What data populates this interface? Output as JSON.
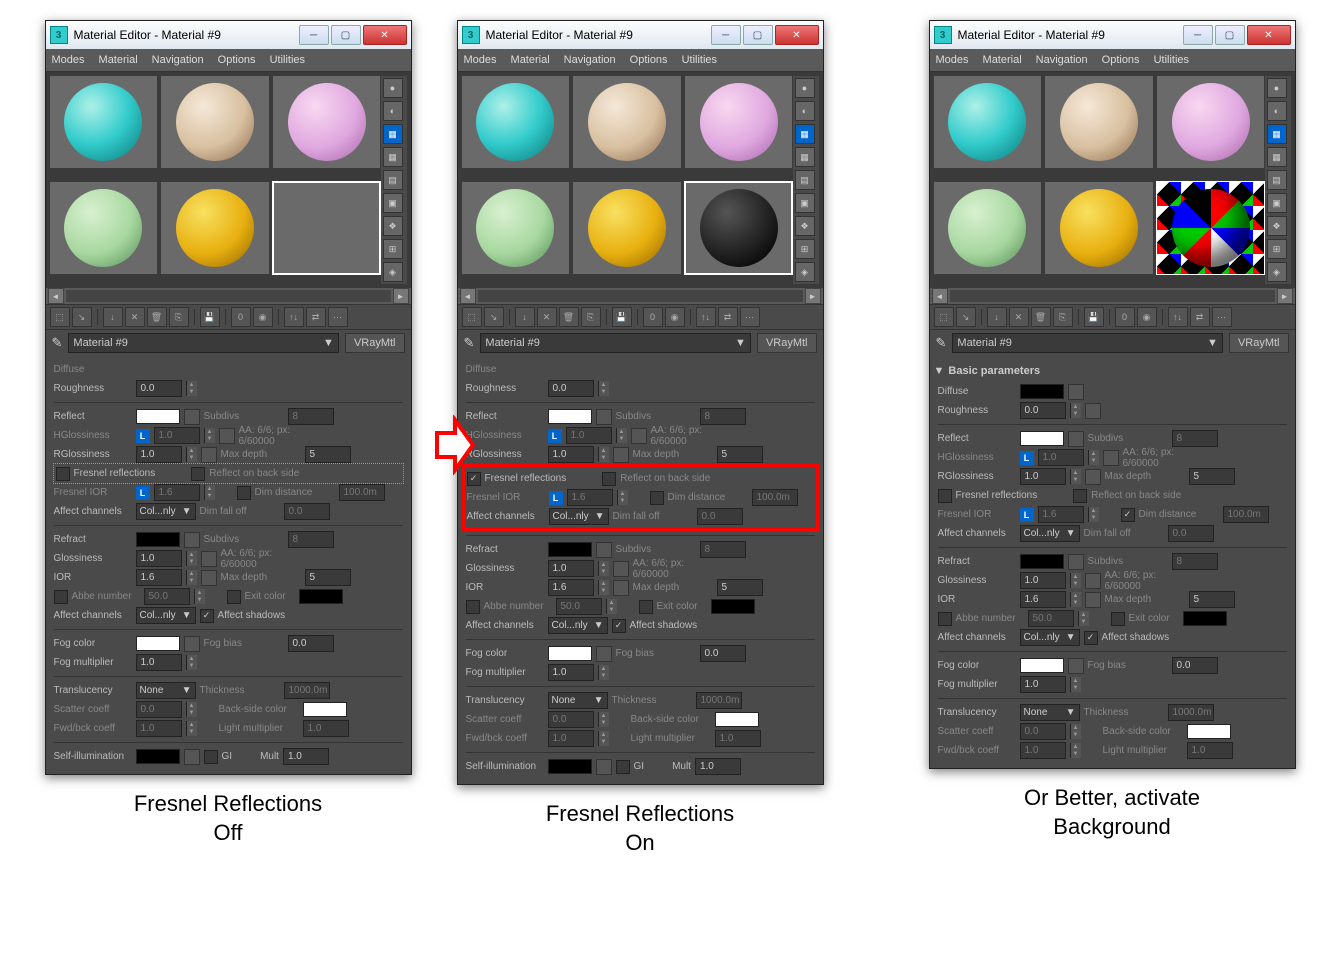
{
  "title": "Material Editor - Material #9",
  "menu": [
    "Modes",
    "Material",
    "Navigation",
    "Options",
    "Utilities"
  ],
  "material_name": "Material #9",
  "material_type": "VRayMtl",
  "rollout": "Basic parameters",
  "labels": {
    "diffuse": "Diffuse",
    "roughness": "Roughness",
    "reflect": "Reflect",
    "hgloss": "HGlossiness",
    "rgloss": "RGlossiness",
    "fresnel": "Fresnel reflections",
    "fresnelior": "Fresnel IOR",
    "affectch": "Affect channels",
    "subdivs": "Subdivs",
    "aa": "AA: 6/6; px: 6/60000",
    "maxdepth": "Max depth",
    "backside": "Reflect on back side",
    "dimdist": "Dim distance",
    "dimfall": "Dim fall off",
    "refract": "Refract",
    "gloss": "Glossiness",
    "ior": "IOR",
    "abbe": "Abbe number",
    "exit": "Exit color",
    "shadows": "Affect shadows",
    "fog": "Fog color",
    "fogmult": "Fog multiplier",
    "fogbias": "Fog bias",
    "trans": "Translucency",
    "thick": "Thickness",
    "scatter": "Scatter coeff",
    "backcol": "Back-side color",
    "fwdbck": "Fwd/bck coeff",
    "lightmult": "Light multiplier",
    "selfillum": "Self-illumination",
    "gi": "GI",
    "mult": "Mult"
  },
  "vals": {
    "roughness": "0.0",
    "hgloss": "1.0",
    "rgloss": "1.0",
    "fresnelior": "1.6",
    "subdivs": "8",
    "maxdepth": "5",
    "dimdist": "100.0m",
    "dimfall": "0.0",
    "gloss": "1.0",
    "ior": "1.6",
    "abbe": "50.0",
    "refr_subdivs": "8",
    "refr_maxdepth": "5",
    "fogmult": "1.0",
    "fogbias": "0.0",
    "thick": "1000.0m",
    "scatter": "0.0",
    "fwdbck": "1.0",
    "lightmult": "1.0",
    "mult": "1.0",
    "affectch": "Col...nly",
    "trans": "None"
  },
  "captions": [
    "Fresnel Reflections\nOff",
    "Fresnel Reflections\nOn",
    "Or Better, activate\nBackground"
  ]
}
